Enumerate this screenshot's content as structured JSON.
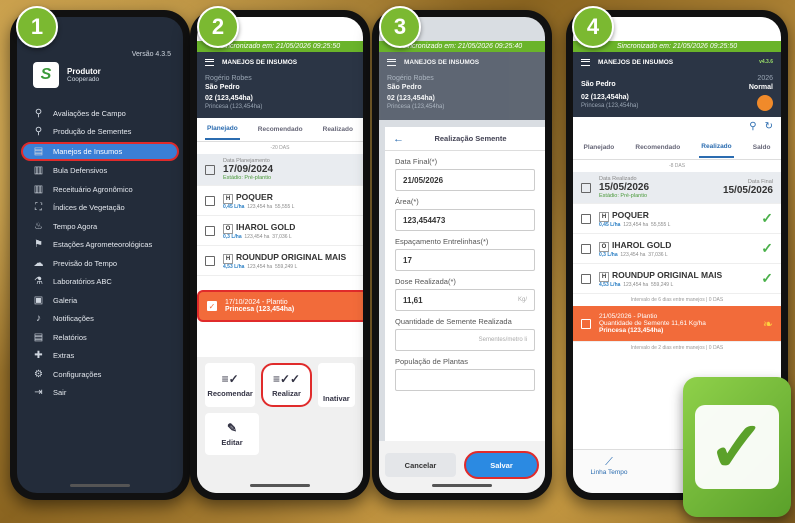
{
  "steps": [
    "1",
    "2",
    "3",
    "4"
  ],
  "phone1": {
    "version": "Versão 4.3.5",
    "profile_name": "Produtor",
    "profile_role": "Cooperado",
    "menu": [
      {
        "label": "Avaliações de Campo",
        "icon": "field-evaluation-icon",
        "glyph": "⚲"
      },
      {
        "label": "Produção de Sementes",
        "icon": "seed-production-icon",
        "glyph": "⚲"
      },
      {
        "label": "Manejos de Insumos",
        "icon": "inputs-management-icon",
        "glyph": "▤"
      },
      {
        "label": "Bula Defensivos",
        "icon": "pesticide-label-icon",
        "glyph": "▥"
      },
      {
        "label": "Receituário Agronômico",
        "icon": "prescription-icon",
        "glyph": "▥"
      },
      {
        "label": "Índices de Vegetação",
        "icon": "vegetation-index-icon",
        "glyph": "⛶"
      },
      {
        "label": "Tempo Agora",
        "icon": "thermometer-icon",
        "glyph": "♨"
      },
      {
        "label": "Estações Agrometeorológicas",
        "icon": "weather-station-icon",
        "glyph": "⚑"
      },
      {
        "label": "Previsão do Tempo",
        "icon": "cloud-icon",
        "glyph": "☁"
      },
      {
        "label": "Laboratórios ABC",
        "icon": "laboratory-icon",
        "glyph": "⚗"
      },
      {
        "label": "Galeria",
        "icon": "gallery-icon",
        "glyph": "▣"
      },
      {
        "label": "Notificações",
        "icon": "bell-icon",
        "glyph": "♪"
      },
      {
        "label": "Relatórios",
        "icon": "report-icon",
        "glyph": "▤"
      },
      {
        "label": "Extras",
        "icon": "plus-icon",
        "glyph": "✚"
      },
      {
        "label": "Configurações",
        "icon": "gear-icon",
        "glyph": "⚙"
      },
      {
        "label": "Sair",
        "icon": "logout-icon",
        "glyph": "⇥"
      }
    ]
  },
  "phone2": {
    "sync": "Sincronizado em: 21/05/2026 09:25:50",
    "title": "MANEJOS DE INSUMOS",
    "owner": "Rogério Robes",
    "farm": "São Pedro",
    "plot": "02 (123,454ha)",
    "plot_sub": "Princesa (123,454ha)",
    "tabs": [
      "Planejado",
      "Recomendado",
      "Realizado"
    ],
    "sep": "-20 DAS",
    "plan_label": "Data Planejamento",
    "plan_date": "17/09/2024",
    "plan_stage": "Estádio: Pré-plantio",
    "products": [
      {
        "code": "H",
        "name": "POQUER",
        "rate": "0,45 L/ha",
        "area": "123,454 ha",
        "vol": "55,555 L"
      },
      {
        "code": "O",
        "name": "IHAROL GOLD",
        "rate": "0,3 L/ha",
        "area": "123,454 ha",
        "vol": "37,036 L"
      },
      {
        "code": "H",
        "name": "ROUNDUP ORIGINAL MAIS",
        "rate": "4,53 L/ha",
        "area": "123,454 ha",
        "vol": "559,249 L"
      }
    ],
    "selected_line1": "17/10/2024 - Plantio",
    "selected_line2": "Princesa (123,454ha)",
    "buttons": [
      "Recomendar",
      "Realizar",
      "Inativar",
      "Editar"
    ]
  },
  "phone3": {
    "sync": "Sincronizado em: 21/05/2026 09:25:40",
    "title": "MANEJOS DE INSUMOS",
    "owner": "Rogério Robes",
    "farm": "São Pedro",
    "plot": "02 (123,454ha)",
    "plot_sub": "Princesa (123,454ha)",
    "form_title": "Realização Semente",
    "fields": [
      {
        "label": "Data Final(*)",
        "value": "21/05/2026",
        "unit": ""
      },
      {
        "label": "Área(*)",
        "value": "123,454473",
        "unit": ""
      },
      {
        "label": "Espaçamento Entrelinhas(*)",
        "value": "17",
        "unit": ""
      },
      {
        "label": "Dose Realizada(*)",
        "value": "11,61",
        "unit": "Kg/"
      },
      {
        "label": "Quantidade de Semente Realizada",
        "value": "",
        "unit": "Sementes/metro li"
      },
      {
        "label": "População de Plantas",
        "value": "",
        "unit": ""
      }
    ],
    "cancel": "Cancelar",
    "save": "Salvar"
  },
  "phone4": {
    "sync": "Sincronizado em: 21/05/2026 09:25:50",
    "title": "MANEJOS DE INSUMOS",
    "version": "v4.3.6",
    "farm": "São Pedro",
    "plot": "02 (123,454ha)",
    "plot_sub": "Princesa (123,454ha)",
    "year": "2026",
    "status": "Normal",
    "tabs": [
      "Planejado",
      "Recomendado",
      "Realizado",
      "Saldo"
    ],
    "sep": "-8 DAS",
    "real_label": "Data Realizado",
    "real_date": "15/05/2026",
    "final_label": "Data Final",
    "final_date": "15/05/2026",
    "real_stage": "Estádio: Pré-plantio",
    "products": [
      {
        "code": "H",
        "name": "POQUER",
        "rate": "0,45 L/ha",
        "area": "123,454 ha",
        "vol": "55,555 L"
      },
      {
        "code": "O",
        "name": "IHAROL GOLD",
        "rate": "0,3 L/ha",
        "area": "123,454 ha",
        "vol": "37,036 L"
      },
      {
        "code": "H",
        "name": "ROUNDUP ORIGINAL MAIS",
        "rate": "4,53 L/ha",
        "area": "123,454 ha",
        "vol": "559,249 L"
      }
    ],
    "interval1": "Intervalo de 6 dias entre manejos | 0 DAS",
    "orange_line1": "21/05/2026 - Plantio",
    "orange_line2": "Quantidade de Semente 11,61 Kg/ha",
    "orange_line3": "Princesa (123,454ha)",
    "interval2": "Intervalo de 2 dias entre manejos | 0 DAS",
    "bottom_tab": "Linha Tempo"
  },
  "colors": {
    "green": "#6ab42a",
    "dark": "#2b3545",
    "orange": "#f26b3a",
    "blue": "#2b6cb0",
    "red": "#e02b2b"
  }
}
